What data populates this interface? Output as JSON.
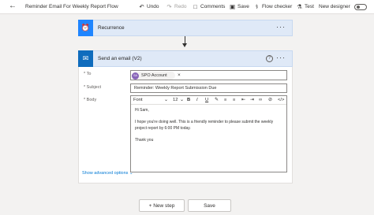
{
  "header": {
    "title": "Reminder Email For Weekly Report Flow",
    "undo": "Undo",
    "redo": "Redo",
    "comments": "Comments",
    "save": "Save",
    "flow_checker": "Flow checker",
    "test": "Test",
    "new_designer": "New designer"
  },
  "trigger": {
    "title": "Recurrence"
  },
  "action": {
    "title": "Send an email (V2)",
    "help": "?",
    "fields": {
      "to_label": "* To",
      "to_chip_initials": "SA",
      "to_chip_text": "SPO Account",
      "subject_label": "* Subject",
      "subject_value": "Reminder: Weekly Report Submission Due",
      "body_label": "* Body"
    },
    "editor": {
      "font": "Font",
      "size": "12",
      "bold": "B",
      "italic": "I",
      "underline": "U",
      "body_lines": [
        "Hi Sam,",
        "I hope you're doing well. This is a friendly reminder to please submit the weekly project report by 6:00 PM today.",
        "Thank you"
      ]
    },
    "advanced": "Show advanced options"
  },
  "footer": {
    "new_step": "+ New step",
    "save": "Save"
  }
}
